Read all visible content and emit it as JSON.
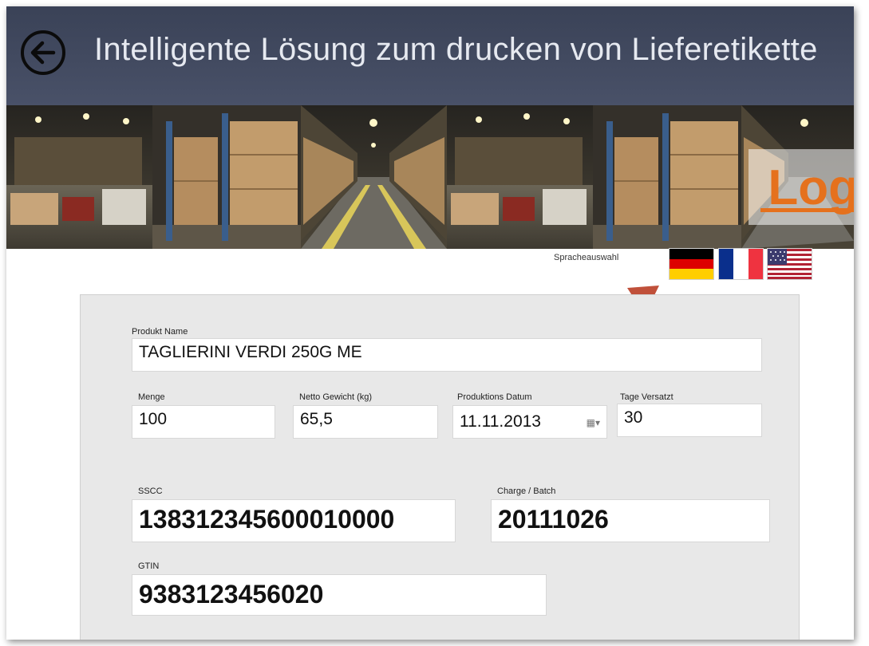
{
  "header": {
    "title": "Intelligente Lösung zum drucken von Lieferetikette"
  },
  "banner": {
    "logo_text": "Log"
  },
  "language": {
    "label": "Spracheauswahl",
    "flags": [
      "de-flag",
      "fr-flag",
      "us-flag"
    ]
  },
  "form": {
    "product_name": {
      "label": "Produkt Name",
      "value": "TAGLIERINI VERDI 250G ME"
    },
    "menge": {
      "label": "Menge",
      "value": "100"
    },
    "netto": {
      "label": "Netto Gewicht (kg)",
      "value": "65,5"
    },
    "datum": {
      "label": "Produktions Datum",
      "value": "11.11.2013"
    },
    "tage": {
      "label": "Tage Versatzt",
      "value": "30"
    },
    "sscc": {
      "label": "SSCC",
      "value": "138312345600010000"
    },
    "charge": {
      "label": "Charge / Batch",
      "value": "20111026"
    },
    "gtin": {
      "label": "GTIN",
      "value": "9383123456020"
    }
  },
  "colors": {
    "titlebar": "#414a60",
    "logo": "#e5711d",
    "arrow": "#c0503a",
    "form_bg": "#e8e8e8"
  }
}
